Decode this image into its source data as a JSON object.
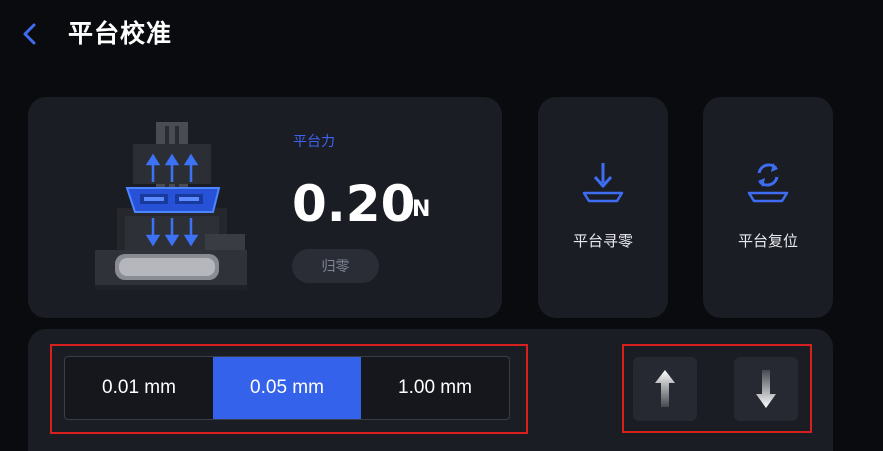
{
  "header": {
    "title": "平台校准"
  },
  "force": {
    "label": "平台力",
    "value": "0.20",
    "unit": "N",
    "zero_label": "归零"
  },
  "actions": [
    {
      "label": "平台寻零",
      "icon": "platform-home-icon"
    },
    {
      "label": "平台复位",
      "icon": "platform-reset-icon"
    }
  ],
  "step": {
    "options": [
      "0.01 mm",
      "0.05 mm",
      "1.00 mm"
    ],
    "selected": "0.05 mm"
  },
  "move": {
    "up_icon": "arrow-up-icon",
    "down_icon": "arrow-down-icon"
  },
  "colors": {
    "accent": "#3462ea",
    "background": "#0a0b0f",
    "card": "#1b1d24",
    "highlight": "#d8201e"
  }
}
